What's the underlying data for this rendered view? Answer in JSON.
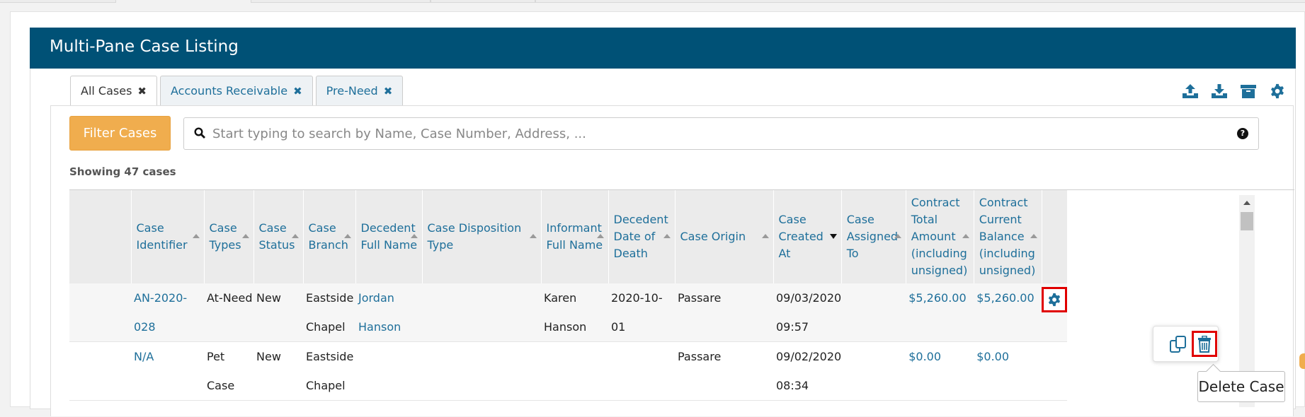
{
  "panel": {
    "title": "Multi-Pane Case Listing"
  },
  "view_tabs": [
    {
      "label": "All Cases",
      "active": true
    },
    {
      "label": "Accounts Receivable",
      "active": false
    },
    {
      "label": "Pre-Need",
      "active": false
    }
  ],
  "toolbar": {
    "icons": [
      "upload-icon",
      "download-icon",
      "archive-icon",
      "gear-icon"
    ]
  },
  "filter": {
    "button_label": "Filter Cases",
    "search_placeholder": "Start typing to search by Name, Case Number, Address, ...",
    "help_glyph": "?"
  },
  "showing_text": "Showing 47 cases",
  "table": {
    "columns": [
      "Case Identifier",
      "Case Types",
      "Case Status",
      "Case Branch",
      "Decedent Full Name",
      "Case Disposition Type",
      "Informant Full Name",
      "Decedent Date of Death",
      "Case Origin",
      "Case Created At",
      "Case Assigned To",
      "Contract Total Amount (including unsigned)",
      "Contract Current Balance (including unsigned)"
    ],
    "sorted_column": "Case Created At",
    "rows": [
      {
        "case_identifier": "AN-2020-028",
        "case_types": "At-Need",
        "case_status": "New",
        "case_branch": "Eastside Chapel",
        "decedent_full_name": "Jordan Hanson",
        "case_disposition_type": "",
        "informant_full_name": "Karen Hanson",
        "decedent_date_of_death": "2020-10-01",
        "case_origin": "Passare",
        "case_created_at": "09/03/2020 09:57",
        "case_assigned_to": "",
        "contract_total_amount": "$5,260.00",
        "contract_current_balance": "$5,260.00"
      },
      {
        "case_identifier": "N/A",
        "case_types": "Pet Case",
        "case_status": "New",
        "case_branch": "Eastside Chapel",
        "decedent_full_name": "",
        "case_disposition_type": "",
        "informant_full_name": "",
        "decedent_date_of_death": "",
        "case_origin": "Passare",
        "case_created_at": "09/02/2020 08:34",
        "case_assigned_to": "",
        "contract_total_amount": "$0.00",
        "contract_current_balance": "$0.00"
      }
    ]
  },
  "row_actions": {
    "icons": [
      "copy-icon",
      "trash-icon"
    ]
  },
  "tooltip": {
    "text": "Delete Case"
  },
  "colors": {
    "header_bg": "#005176",
    "link": "#1e6f9a",
    "filter_button": "#f0ad4e",
    "highlight": "#e00000"
  }
}
